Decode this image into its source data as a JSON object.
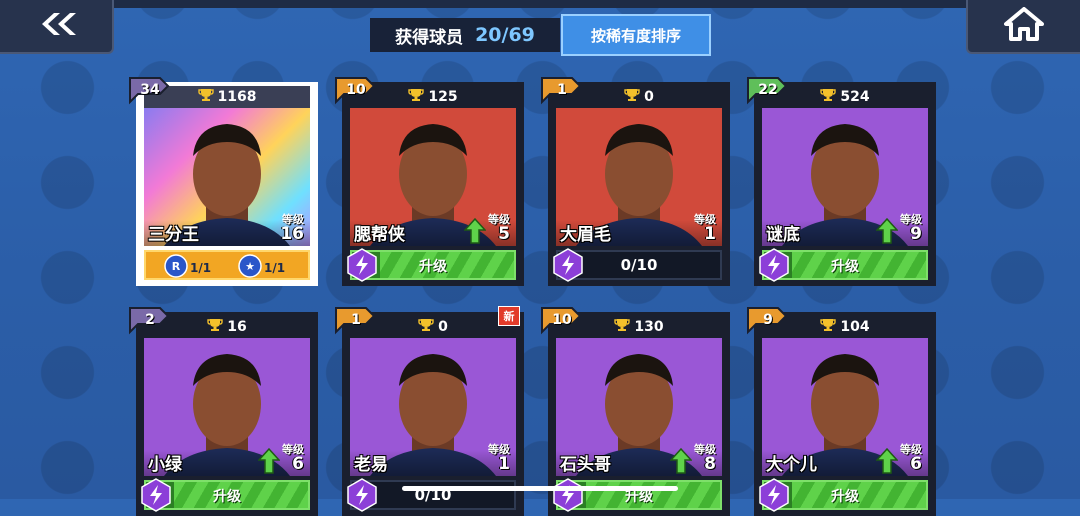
{
  "header": {
    "collected_label": "获得球员",
    "collected_value": "20/69",
    "sort_button": "按稀有度排序",
    "back_icon": "double-chevron-left-icon",
    "home_icon": "home-icon"
  },
  "labels": {
    "level": "等级",
    "upgrade": "升级"
  },
  "cards": [
    {
      "rank": "34",
      "trophies": "1168",
      "name": "三分王",
      "level": "16",
      "bg": "#c7a2f4",
      "badge": "#7a6aa8",
      "selected": true,
      "skills": [
        {
          "icon": "skill-r-icon",
          "value": "1/1"
        },
        {
          "icon": "crown-icon",
          "value": "1/1"
        }
      ]
    },
    {
      "rank": "10",
      "trophies": "125",
      "name": "腮帮侠",
      "level": "5",
      "bg": "#d14a3b",
      "badge": "#e89a2e",
      "action": "upgrade",
      "upgrade_available": true
    },
    {
      "rank": "1",
      "trophies": "0",
      "name": "大眉毛",
      "level": "1",
      "bg": "#d14a3b",
      "badge": "#e89a2e",
      "action": "progress",
      "progress": "0/10"
    },
    {
      "rank": "22",
      "trophies": "524",
      "name": "谜底",
      "level": "9",
      "bg": "#9a57d6",
      "badge": "#5fbf5a",
      "action": "upgrade",
      "upgrade_available": true
    },
    {
      "rank": "2",
      "trophies": "16",
      "name": "小绿",
      "level": "6",
      "bg": "#9a57d6",
      "badge": "#7a6aa8",
      "action": "upgrade",
      "upgrade_available": true
    },
    {
      "rank": "1",
      "trophies": "0",
      "name": "老易",
      "level": "1",
      "bg": "#9a57d6",
      "badge": "#e89a2e",
      "action": "progress",
      "progress": "0/10",
      "new_tag": "新"
    },
    {
      "rank": "10",
      "trophies": "130",
      "name": "石头哥",
      "level": "8",
      "bg": "#9a57d6",
      "badge": "#e89a2e",
      "action": "upgrade",
      "upgrade_available": true
    },
    {
      "rank": "9",
      "trophies": "104",
      "name": "大个儿",
      "level": "6",
      "bg": "#9a57d6",
      "badge": "#e89a2e",
      "action": "upgrade",
      "upgrade_available": true
    }
  ],
  "colors": {
    "trophy": "#f3c12b",
    "upgrade_green": "#5fd24a",
    "gem_purple": "#8c3fd8"
  }
}
